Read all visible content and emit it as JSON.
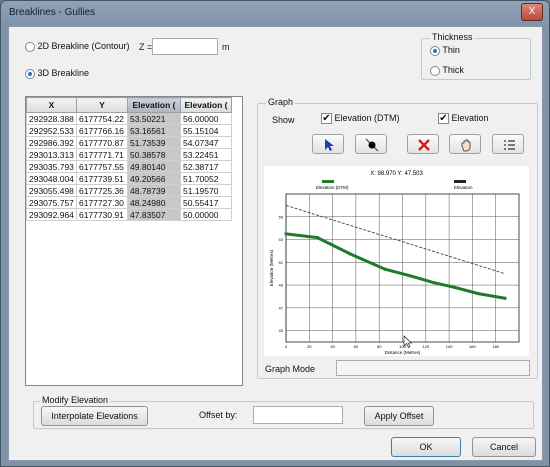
{
  "window": {
    "title": "Breaklines - Gullies",
    "close_glyph": "X"
  },
  "mode": {
    "option_2d": "2D Breakline (Contour)",
    "z_label": "Z =",
    "z_value": "",
    "z_unit": "m",
    "option_3d": "3D Breakline",
    "selected": "3D Breakline"
  },
  "thickness": {
    "title": "Thickness",
    "thin": "Thin",
    "thick": "Thick",
    "selected": "Thin"
  },
  "table": {
    "columns": [
      "X",
      "Y",
      "Elevation (",
      "Elevation ("
    ],
    "rows": [
      [
        "292928.388",
        "6177754.22",
        "53.50221",
        "56.00000"
      ],
      [
        "292952.533",
        "6177766.16",
        "53.16561",
        "55.15104"
      ],
      [
        "292986.392",
        "6177770.87",
        "51.73539",
        "54.07347"
      ],
      [
        "293013.313",
        "6177771.71",
        "50.38578",
        "53.22451"
      ],
      [
        "293035.793",
        "6177757.55",
        "49.80140",
        "52.38717"
      ],
      [
        "293048.004",
        "6177739.51",
        "49.20566",
        "51.70052"
      ],
      [
        "293055.498",
        "6177725.36",
        "48.78739",
        "51.19570"
      ],
      [
        "293075.757",
        "6177727.30",
        "48.24980",
        "50.55417"
      ],
      [
        "293092.964",
        "6177730.91",
        "47.83507",
        "50.00000"
      ]
    ]
  },
  "graph": {
    "title": "Graph",
    "show_label": "Show",
    "check_dtm_label": "Elevation (DTM)",
    "check_elev_label": "Elevation",
    "check_dtm": true,
    "check_elev": true,
    "tools": [
      "pointer-icon",
      "node-icon",
      "delete-icon",
      "hand-pan-icon",
      "list-icon"
    ],
    "mode_label": "Graph Mode",
    "mode_value": ""
  },
  "chart_data": {
    "type": "line",
    "readout": "X: 98.970  Y: 47.503",
    "legend": [
      "Elevation (DTM)",
      "Elevation"
    ],
    "xlabel": "Distance (Metres)",
    "ylabel": "Elevation (Metres)",
    "xlim": [
      0,
      200
    ],
    "ylim": [
      44,
      57
    ],
    "xticks": [
      0,
      20,
      40,
      60,
      80,
      100,
      120,
      140,
      160,
      180
    ],
    "yticks": [
      45,
      47,
      49,
      51,
      53,
      55
    ],
    "grid": true,
    "series": [
      {
        "name": "Elevation (DTM)",
        "color": "#1f7a2e",
        "x": [
          0,
          27,
          55,
          85,
          107,
          127,
          145,
          165,
          188
        ],
        "y": [
          53.5,
          53.17,
          51.74,
          50.39,
          49.8,
          49.21,
          48.79,
          48.25,
          47.84
        ]
      },
      {
        "name": "Elevation",
        "color": "#444444",
        "x": [
          0,
          188
        ],
        "y": [
          56.0,
          50.0
        ]
      }
    ]
  },
  "modify": {
    "title": "Modify Elevation",
    "interpolate": "Interpolate Elevations",
    "offset_label": "Offset by:",
    "offset_value": "",
    "apply": "Apply Offset"
  },
  "footer": {
    "ok": "OK",
    "cancel": "Cancel"
  }
}
